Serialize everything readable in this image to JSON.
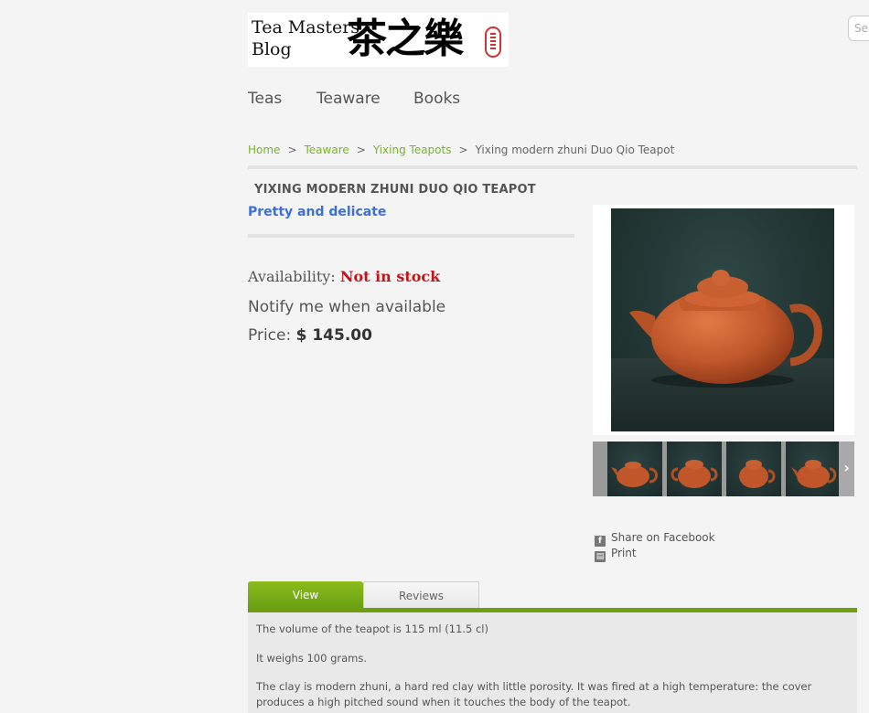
{
  "logo": {
    "text_line1": "Tea Masters",
    "text_line2": "Blog",
    "cjk": "茶之樂"
  },
  "search": {
    "placeholder": "Search"
  },
  "nav": {
    "items": [
      "Teas",
      "Teaware",
      "Books"
    ]
  },
  "breadcrumb": [
    "Home",
    "Teaware",
    "Yixing Teapots",
    "Yixing modern zhuni Duo Qio Teapot"
  ],
  "breadcrumb_separator": ">",
  "product": {
    "title": "YIXING MODERN ZHUNI DUO QIO TEAPOT",
    "subtitle": "Pretty and delicate",
    "availability_label": "Availability:",
    "availability_value": "Not in stock",
    "notify": "Notify me when available",
    "price_label": "Price:",
    "price_value": "$ 145.00"
  },
  "social": {
    "facebook": "Share on Facebook",
    "print": "Print"
  },
  "gallery": {
    "next_arrow": "›",
    "thumbnail_count": 4
  },
  "tabs": {
    "view": "View",
    "reviews": "Reviews"
  },
  "description": [
    "The volume of the teapot is 115 ml (11.5 cl)",
    "It weighs 100 grams.",
    "The clay is modern zhuni, a hard red clay with little porosity. It was fired at a high temperature: the cover produces a high pitched sound when it touches the body of the teapot."
  ],
  "colors": {
    "accent_green": "#7ab32e",
    "tab_green": "#6f9e10",
    "subtitle_blue": "#3e6fd8",
    "out_of_stock_red": "#c0161b",
    "teapot_clay": "#c0562a"
  }
}
